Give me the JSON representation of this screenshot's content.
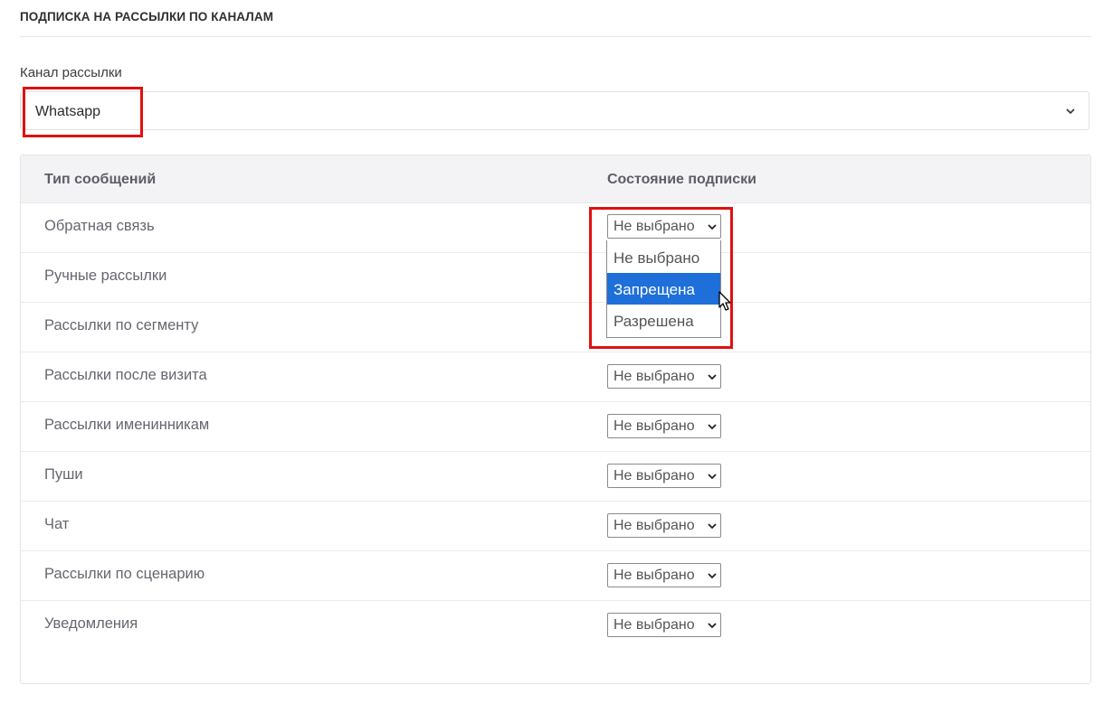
{
  "section": {
    "title": "ПОДПИСКА НА РАССЫЛКИ ПО КАНАЛАМ"
  },
  "channel": {
    "label": "Канал рассылки",
    "value": "Whatsapp",
    "icon": "chevron-down-icon"
  },
  "table": {
    "headers": [
      "Тип сообщений",
      "Состояние подписки"
    ],
    "rows": [
      {
        "label": "Обратная связь",
        "value": "Не выбрано"
      },
      {
        "label": "Ручные рассылки",
        "value": ""
      },
      {
        "label": "Рассылки по сегменту",
        "value": ""
      },
      {
        "label": "Рассылки после визита",
        "value": "Не выбрано"
      },
      {
        "label": "Рассылки именинникам",
        "value": "Не выбрано"
      },
      {
        "label": "Пуши",
        "value": "Не выбрано"
      },
      {
        "label": "Чат",
        "value": "Не выбрано"
      },
      {
        "label": "Рассылки по сценарию",
        "value": "Не выбрано"
      },
      {
        "label": "Уведомления",
        "value": "Не выбрано"
      }
    ]
  },
  "dropdown": {
    "options": [
      "Не выбрано",
      "Запрещена",
      "Разрешена"
    ],
    "highlighted": "Запрещена"
  },
  "colors": {
    "highlight_border": "#e01010",
    "selected_option": "#1e6fd9",
    "header_bg": "#f3f3f6"
  }
}
